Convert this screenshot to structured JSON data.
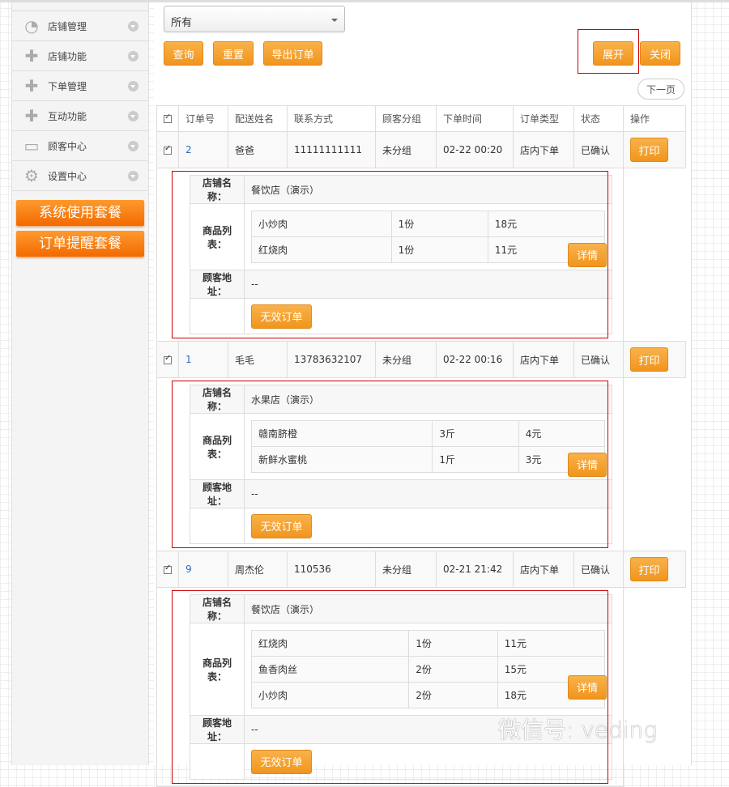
{
  "sidebar": {
    "items": [
      {
        "label": "店铺管理",
        "icon": "pie-chart-icon"
      },
      {
        "label": "店铺功能",
        "icon": "plus-icon"
      },
      {
        "label": "下单管理",
        "icon": "plus-icon"
      },
      {
        "label": "互动功能",
        "icon": "plus-icon"
      },
      {
        "label": "顾客中心",
        "icon": "inbox-icon"
      },
      {
        "label": "设置中心",
        "icon": "gear-icon"
      }
    ],
    "packages": [
      "系统使用套餐",
      "订单提醒套餐"
    ]
  },
  "filter": {
    "selected": "所有"
  },
  "toolbar": {
    "query": "查询",
    "reset": "重置",
    "export": "导出订单",
    "expand": "展开",
    "close": "关闭",
    "next_page": "下一页"
  },
  "table": {
    "headers": [
      "订单号",
      "配送姓名",
      "联系方式",
      "顾客分组",
      "下单时间",
      "订单类型",
      "状态",
      "操作"
    ],
    "print_label": "打印",
    "detail_label": "详情",
    "invalid_label": "无效订单",
    "labels": {
      "store": "店铺名称：",
      "items": "商品列表：",
      "address": "顾客地址："
    },
    "orders": [
      {
        "id": "2",
        "name": "爸爸",
        "phone": "11111111111",
        "group": "未分组",
        "time": "02-22 00:20",
        "type": "店内下单",
        "status": "已确认",
        "store": "餐饮店（演示）",
        "address": "--",
        "items": [
          [
            "小炒肉",
            "1份",
            "18元"
          ],
          [
            "红烧肉",
            "1份",
            "11元"
          ]
        ]
      },
      {
        "id": "1",
        "name": "毛毛",
        "phone": "13783632107",
        "group": "未分组",
        "time": "02-22 00:16",
        "type": "店内下单",
        "status": "已确认",
        "store": "水果店（演示）",
        "address": "--",
        "items": [
          [
            "赣南脐橙",
            "3斤",
            "4元"
          ],
          [
            "新鲜水蜜桃",
            "1斤",
            "3元"
          ]
        ]
      },
      {
        "id": "9",
        "name": "周杰伦",
        "phone": "110536",
        "group": "未分组",
        "time": "02-21 21:42",
        "type": "店内下单",
        "status": "已确认",
        "store": "餐饮店（演示）",
        "address": "--",
        "items": [
          [
            "红烧肉",
            "1份",
            "11元"
          ],
          [
            "鱼香肉丝",
            "2份",
            "15元"
          ],
          [
            "小炒肉",
            "2份",
            "18元"
          ]
        ]
      }
    ]
  },
  "watermark": "微信号: veding",
  "colors": {
    "accent": "#f0951e",
    "package": "#f26a00",
    "highlight": "#cc0000",
    "link": "#2a6ebb"
  }
}
